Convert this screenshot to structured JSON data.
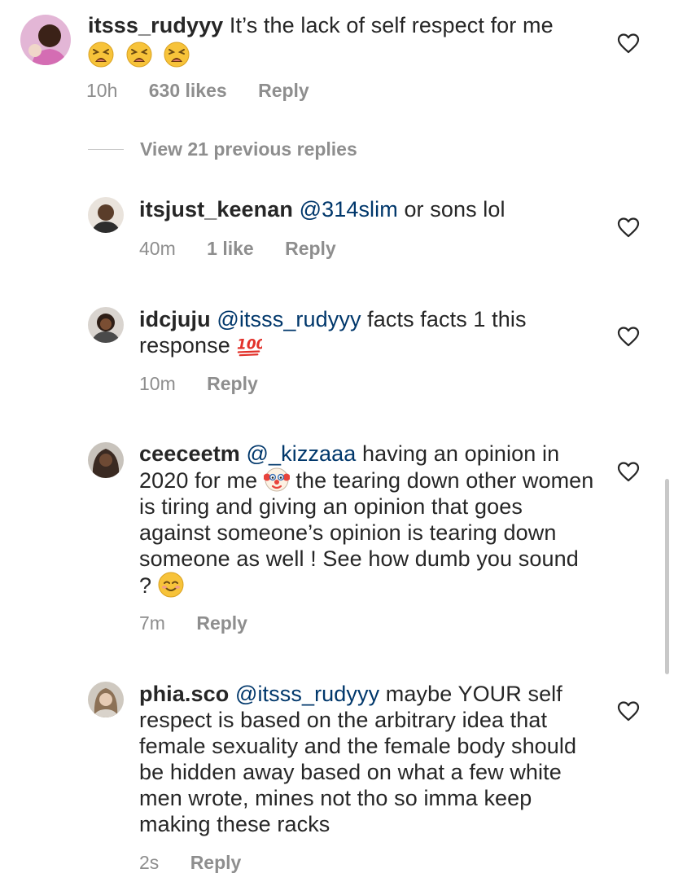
{
  "comment_main": {
    "username": "itsss_rudyyy",
    "text": "It’s the lack of self respect for me",
    "emojis": [
      "tired-face",
      "tired-face",
      "tired-face"
    ],
    "time": "10h",
    "likes": "630 likes",
    "reply": "Reply"
  },
  "view_replies": "View 21 previous replies",
  "replies": [
    {
      "username": "itsjust_keenan",
      "mention": "@314slim",
      "text": " or sons lol",
      "time": "40m",
      "likes": "1 like",
      "reply": "Reply"
    },
    {
      "username": "idcjuju",
      "mention": "@itsss_rudyyy",
      "text": " facts facts 1 this response",
      "emoji": "hundred-points",
      "time": "10m",
      "reply": "Reply"
    },
    {
      "username": "ceeceetm",
      "mention": "@_kizzaaa",
      "text_a": " having an opinion in 2020 for me",
      "emoji_a": "clown-face",
      "text_b": " the tearing down other women is tiring and giving an opinion that goes against someone’s opinion is tearing down someone as well ! See how dumb you sound ?",
      "emoji_b": "smiling-face",
      "time": "7m",
      "reply": "Reply"
    },
    {
      "username": "phia.sco",
      "mention": "@itsss_rudyyy",
      "text": " maybe YOUR self respect is based on the arbitrary idea that female sexuality and the female body should be hidden away based on what a few white men wrote, mines not tho so imma keep making these racks",
      "time": "2s",
      "reply": "Reply"
    }
  ],
  "colors": {
    "text": "#262626",
    "secondary": "#8e8e8e",
    "mention": "#00376b"
  }
}
